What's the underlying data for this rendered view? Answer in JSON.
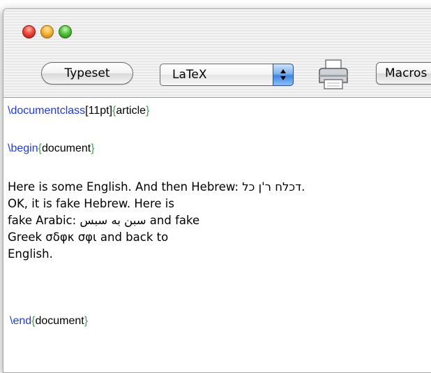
{
  "toolbar": {
    "typeset_label": "Typeset",
    "format_selected": "LaTeX",
    "macros_label": "Macros",
    "printer_icon": "printer-icon"
  },
  "editor": {
    "line1": {
      "cmd": "\\documentclass",
      "opt": "[11pt]",
      "open": "{",
      "arg": "article",
      "close": "}"
    },
    "line2": {
      "cmd": "\\begin",
      "open": "{",
      "arg": "document",
      "close": "}"
    },
    "body_lines": [
      "Here is some English. And then Hebrew: דכלח ר'ן כל.",
      "OK, it is fake Hebrew. Here is",
      "fake Arabic: سبن به سبس and fake",
      "Greek σδφκ σφι and back to",
      "English."
    ],
    "line_end": {
      "cmd": "\\end",
      "open": "{",
      "arg": "document",
      "close": "}"
    }
  },
  "colors": {
    "command": "#1f3ad9",
    "brace": "#33a64a",
    "text": "#000000"
  }
}
